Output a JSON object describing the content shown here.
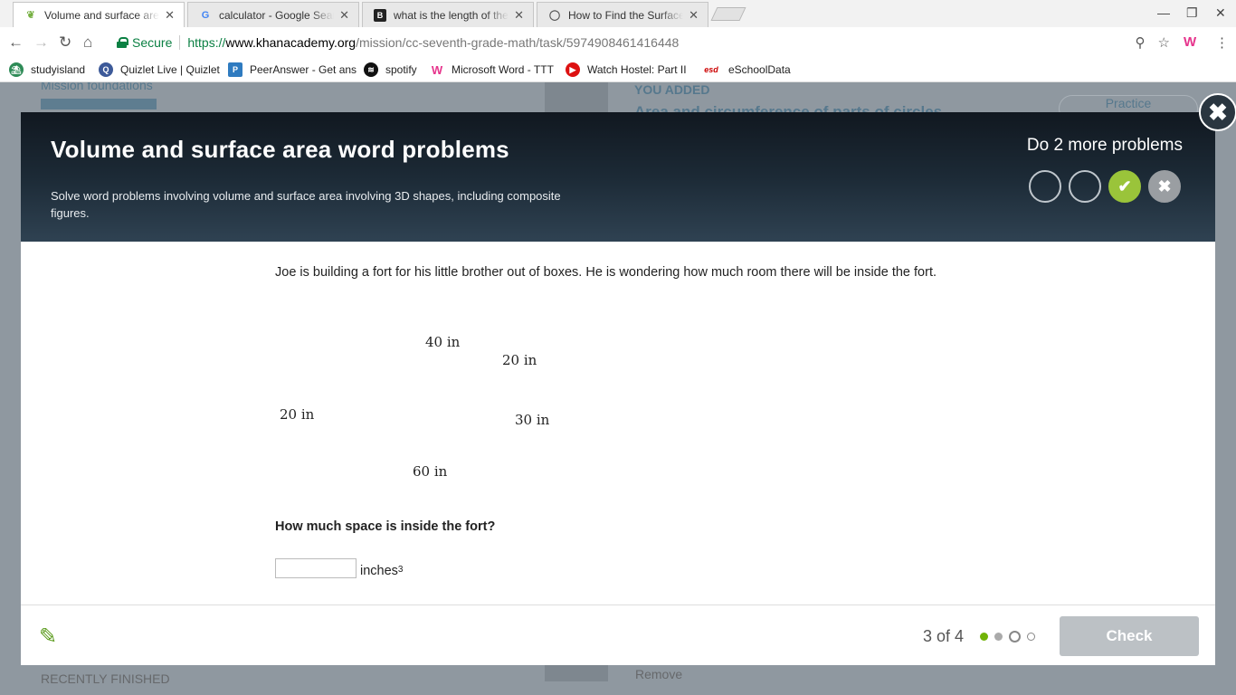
{
  "browser": {
    "tabs": [
      {
        "title": "Volume and surface area",
        "active": true,
        "favicon": "leaf-icon"
      },
      {
        "title": "calculator - Google Search",
        "active": false,
        "favicon": "google-icon"
      },
      {
        "title": "what is the length of the",
        "active": false,
        "favicon": "brainly-icon"
      },
      {
        "title": "How to Find the Surface",
        "active": false,
        "favicon": "globe-icon"
      }
    ],
    "secure_label": "Secure",
    "url_scheme": "https://",
    "url_host": "www.khanacademy.org",
    "url_path": "/mission/cc-seventh-grade-math/task/5974908461416448",
    "bookmarks": [
      {
        "label": "studyisland",
        "icon": "island-icon"
      },
      {
        "label": "Quizlet Live | Quizlet",
        "icon": "quizlet-icon"
      },
      {
        "label": "PeerAnswer - Get ans",
        "icon": "peeranswer-icon"
      },
      {
        "label": "spotify",
        "icon": "spotify-icon"
      },
      {
        "label": "Microsoft Word - TTT",
        "icon": "word-icon"
      },
      {
        "label": "Watch Hostel: Part II",
        "icon": "play-icon"
      },
      {
        "label": "eSchoolData",
        "icon": "esd-icon"
      }
    ]
  },
  "background": {
    "mission": "Mission foundations",
    "you_added": "YOU ADDED",
    "added_skill": "Area and circumference of parts of circles",
    "practice": "Practice",
    "remove": "Remove",
    "recently_finished": "RECENTLY FINISHED"
  },
  "modal": {
    "title": "Volume and surface area word problems",
    "description": "Solve word problems involving volume and surface area involving 3D shapes, including composite figures.",
    "remaining": "Do 2 more problems",
    "attempts": [
      "empty",
      "empty",
      "correct",
      "wrong"
    ],
    "problem_text": "Joe is building a fort for his little brother out of boxes. He is wondering how much room there will be inside the fort.",
    "figure_labels": {
      "top": "40 in",
      "depth": "20 in",
      "left_height": "20 in",
      "right_height": "30 in",
      "bottom": "60 in"
    },
    "question": "How much space is inside the fort?",
    "answer_value": "",
    "answer_unit": "inches",
    "answer_unit_exp": "3",
    "progress": "3 of 4",
    "check_label": "Check"
  },
  "colors": {
    "accent_green": "#71b307",
    "correct_green": "#9ac43a",
    "check_disabled": "#bcc1c5",
    "header_dark": "#1c2a36"
  }
}
